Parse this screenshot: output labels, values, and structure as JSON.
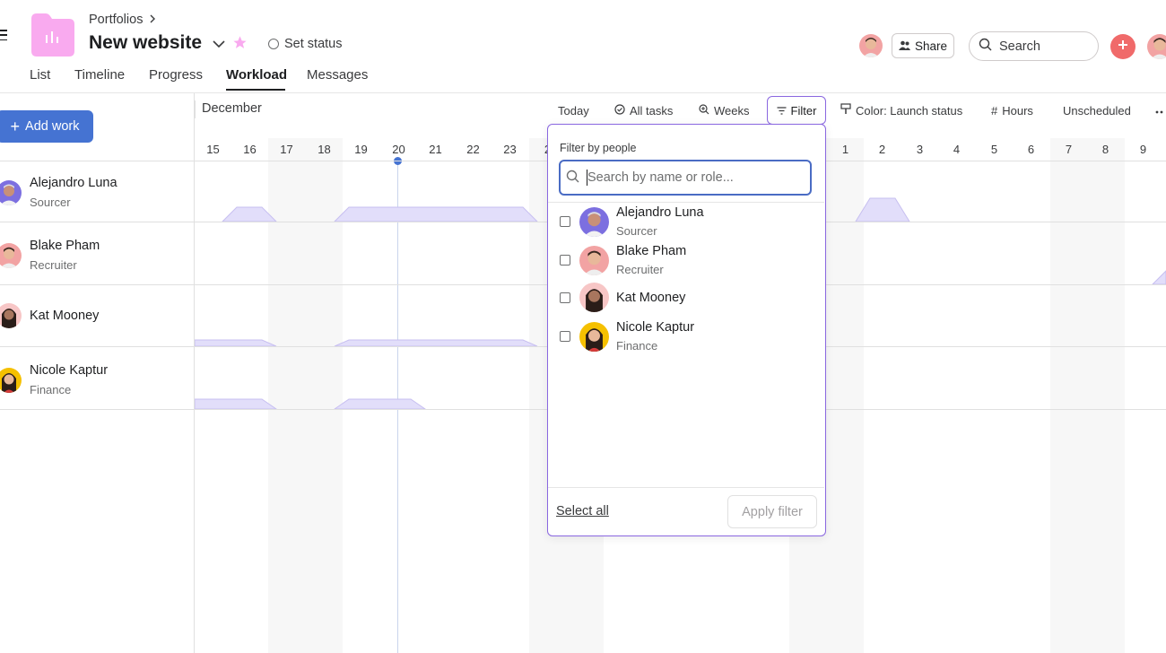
{
  "header": {
    "breadcrumb": "Portfolios",
    "title": "New website",
    "set_status": "Set status",
    "share_label": "Share",
    "search_label": "Search"
  },
  "tabs": [
    {
      "label": "List"
    },
    {
      "label": "Timeline"
    },
    {
      "label": "Progress"
    },
    {
      "label": "Workload",
      "active": true
    },
    {
      "label": "Messages"
    }
  ],
  "toolbar": {
    "add_work": "Add work",
    "today": "Today",
    "all_tasks": "All tasks",
    "weeks": "Weeks",
    "filter": "Filter",
    "color": "Color: Launch status",
    "hours": "Hours",
    "unscheduled": "Unscheduled"
  },
  "calendar": {
    "month": "December",
    "days_left": [
      "15",
      "16",
      "17",
      "18",
      "19",
      "20",
      "21",
      "22",
      "23",
      "2"
    ],
    "days_right": [
      "1",
      "2",
      "3",
      "4",
      "5",
      "6",
      "7",
      "8",
      "9"
    ]
  },
  "people": [
    {
      "name": "Alejandro Luna",
      "role": "Sourcer"
    },
    {
      "name": "Blake Pham",
      "role": "Recruiter"
    },
    {
      "name": "Kat Mooney",
      "role": ""
    },
    {
      "name": "Nicole Kaptur",
      "role": "Finance"
    }
  ],
  "filter_dropdown": {
    "title": "Filter by people",
    "search_placeholder": "Search by name or role...",
    "select_all": "Select all",
    "apply": "Apply filter"
  },
  "colors": {
    "accent": "#4573d2",
    "filter_border": "#8a67e0",
    "workload_fill": "#e2defa",
    "workload_stroke": "#c7bff0",
    "add_red": "#f06a6a"
  }
}
